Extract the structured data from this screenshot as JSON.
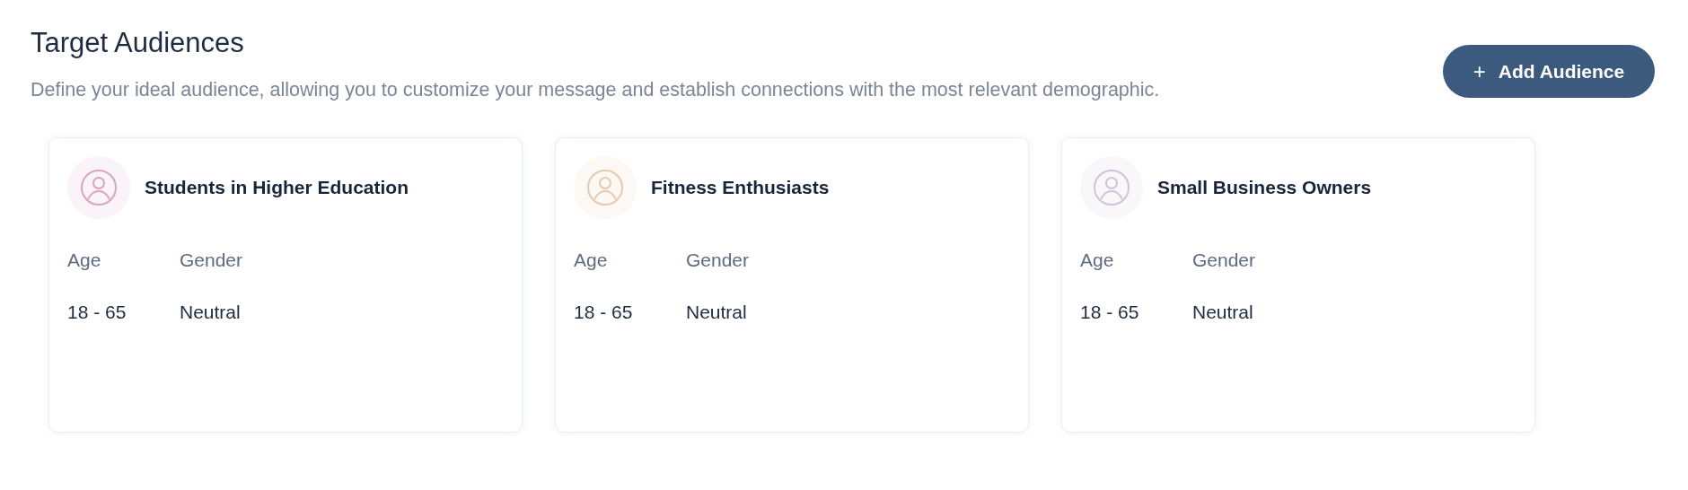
{
  "header": {
    "title": "Target Audiences",
    "description": "Define your ideal audience, allowing you to customize your message and establish connections with the most relevant demographic.",
    "add_button": {
      "icon": "+",
      "label": "Add Audience"
    }
  },
  "audiences": [
    {
      "name": "Students in Higher Education",
      "color": "#d8a4c0",
      "fields": [
        {
          "label": "Age",
          "value": "18 - 65"
        },
        {
          "label": "Gender",
          "value": "Neutral"
        }
      ]
    },
    {
      "name": "Fitness Enthusiasts",
      "color": "#e6c9ae",
      "fields": [
        {
          "label": "Age",
          "value": "18 - 65"
        },
        {
          "label": "Gender",
          "value": "Neutral"
        }
      ]
    },
    {
      "name": "Small Business Owners",
      "color": "#cfc3dc",
      "fields": [
        {
          "label": "Age",
          "value": "18 - 65"
        },
        {
          "label": "Gender",
          "value": "Neutral"
        }
      ]
    }
  ]
}
